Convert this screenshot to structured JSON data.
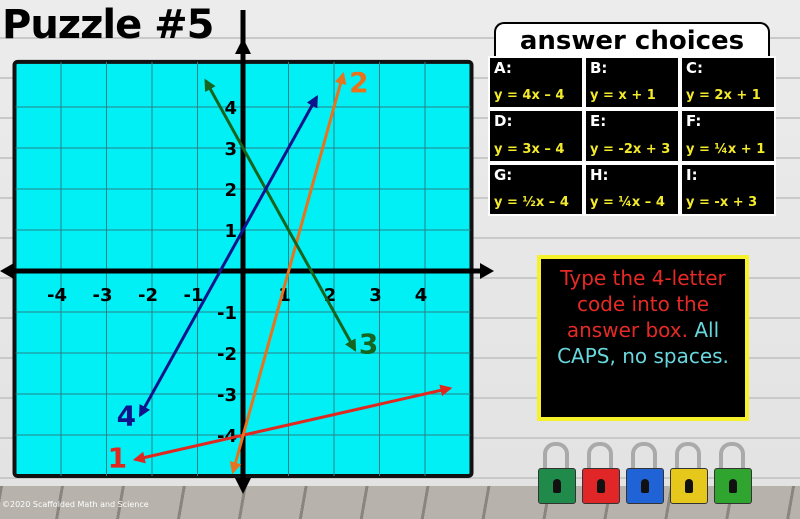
{
  "title": "Puzzle #5",
  "answer_choices": {
    "heading": "answer choices",
    "items": [
      {
        "letter": "A:",
        "equation": "y = 4x – 4"
      },
      {
        "letter": "B:",
        "equation": "y = x + 1"
      },
      {
        "letter": "C:",
        "equation": "y = 2x + 1"
      },
      {
        "letter": "D:",
        "equation": "y = 3x – 4"
      },
      {
        "letter": "E:",
        "equation": "y = -2x + 3"
      },
      {
        "letter": "F:",
        "equation": "y = ¼x + 1"
      },
      {
        "letter": "G:",
        "equation": "y = ½x – 4"
      },
      {
        "letter": "H:",
        "equation": "y = ¼x – 4"
      },
      {
        "letter": "I:",
        "equation": "y = -x + 3"
      }
    ]
  },
  "instructions": {
    "part1": "Type the 4-letter code into the answer box.",
    "part2": "All CAPS, no spaces."
  },
  "locks": [
    {
      "color": "#1f8a4a"
    },
    {
      "color": "#e02626"
    },
    {
      "color": "#1f63d6"
    },
    {
      "color": "#e6c81d"
    },
    {
      "color": "#2fa52f"
    }
  ],
  "copyright": "©2020 Scaffolded Math and Science",
  "chart_data": {
    "type": "line",
    "xlim": [
      -5,
      5
    ],
    "ylim": [
      -5,
      5.1
    ],
    "grid": true,
    "background": "#00f0f5",
    "x_ticks": [
      "-4",
      "-3",
      "-2",
      "-1",
      "1",
      "2",
      "3",
      "4"
    ],
    "y_ticks": [
      "4",
      "3",
      "2",
      "1",
      "-1",
      "-2",
      "-3",
      "-4"
    ],
    "series": [
      {
        "name": "1",
        "color": "#e0281f",
        "points": [
          [
            -2.37,
            -4.6
          ],
          [
            4.55,
            -2.86
          ]
        ]
      },
      {
        "name": "2",
        "color": "#e8731c",
        "points": [
          [
            -0.22,
            -4.9
          ],
          [
            2.2,
            4.8
          ]
        ]
      },
      {
        "name": "3",
        "color": "#17641f",
        "points": [
          [
            -0.82,
            4.64
          ],
          [
            2.46,
            -1.92
          ]
        ]
      },
      {
        "name": "4",
        "color": "#10148a",
        "points": [
          [
            -2.26,
            -3.52
          ],
          [
            1.62,
            4.24
          ]
        ]
      }
    ]
  }
}
